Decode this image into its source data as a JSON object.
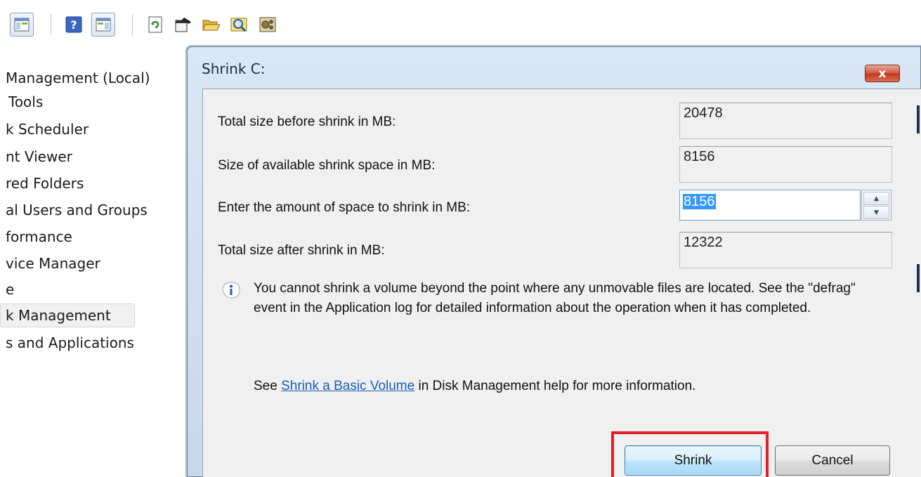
{
  "tree": {
    "items": [
      {
        "label": " Management (Local)"
      },
      {
        "label": "Tools"
      },
      {
        "label": "k Scheduler"
      },
      {
        "label": "nt Viewer"
      },
      {
        "label": "red Folders"
      },
      {
        "label": "al Users and Groups"
      },
      {
        "label": "formance"
      },
      {
        "label": "vice Manager"
      },
      {
        "label": "e"
      },
      {
        "label": "k Management"
      },
      {
        "label": "s and Applications"
      }
    ]
  },
  "dialog": {
    "title": "Shrink C:",
    "close_label": "x",
    "fields": {
      "total_before_label": "Total size before shrink in MB:",
      "total_before_value": "20478",
      "available_label": "Size of available shrink space in MB:",
      "available_value": "8156",
      "amount_label": "Enter the amount of space to shrink in MB:",
      "amount_value": "8156",
      "total_after_label": "Total size after shrink in MB:",
      "total_after_value": "12322"
    },
    "info_text": "You cannot shrink a volume beyond the point where any unmovable files are located. See the \"defrag\" event in the Application log for detailed information about the operation when it has completed.",
    "help": {
      "prefix": "See ",
      "link": "Shrink a Basic Volume",
      "suffix": " in Disk Management help for more information."
    },
    "buttons": {
      "shrink": "Shrink",
      "cancel": "Cancel"
    }
  },
  "colors": {
    "highlight": "#e0202a",
    "link": "#1a5fb4",
    "selection": "#3399ff"
  }
}
